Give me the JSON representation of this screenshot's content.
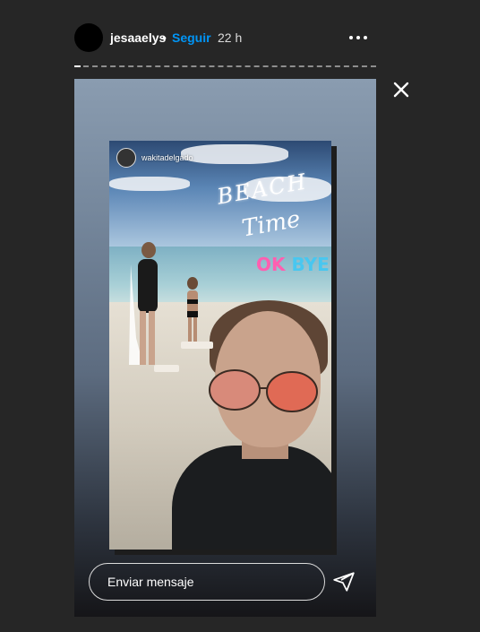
{
  "header": {
    "username": "jesaaelys",
    "separator": "•",
    "follow_label": "Seguir",
    "time_ago": "22 h",
    "more_icon": "more-horizontal-icon"
  },
  "viewer": {
    "close_icon": "close-icon",
    "progress": 0.02
  },
  "story": {
    "mention_username": "wakitadelgado",
    "sticker_beach": "BEACH",
    "sticker_time": "Time",
    "sticker_ok": "OK",
    "sticker_bye": "BYE"
  },
  "reply": {
    "placeholder": "Enviar mensaje",
    "send_icon": "send-icon"
  },
  "colors": {
    "background": "#262626",
    "link": "#0095f6",
    "text": "#ffffff"
  }
}
